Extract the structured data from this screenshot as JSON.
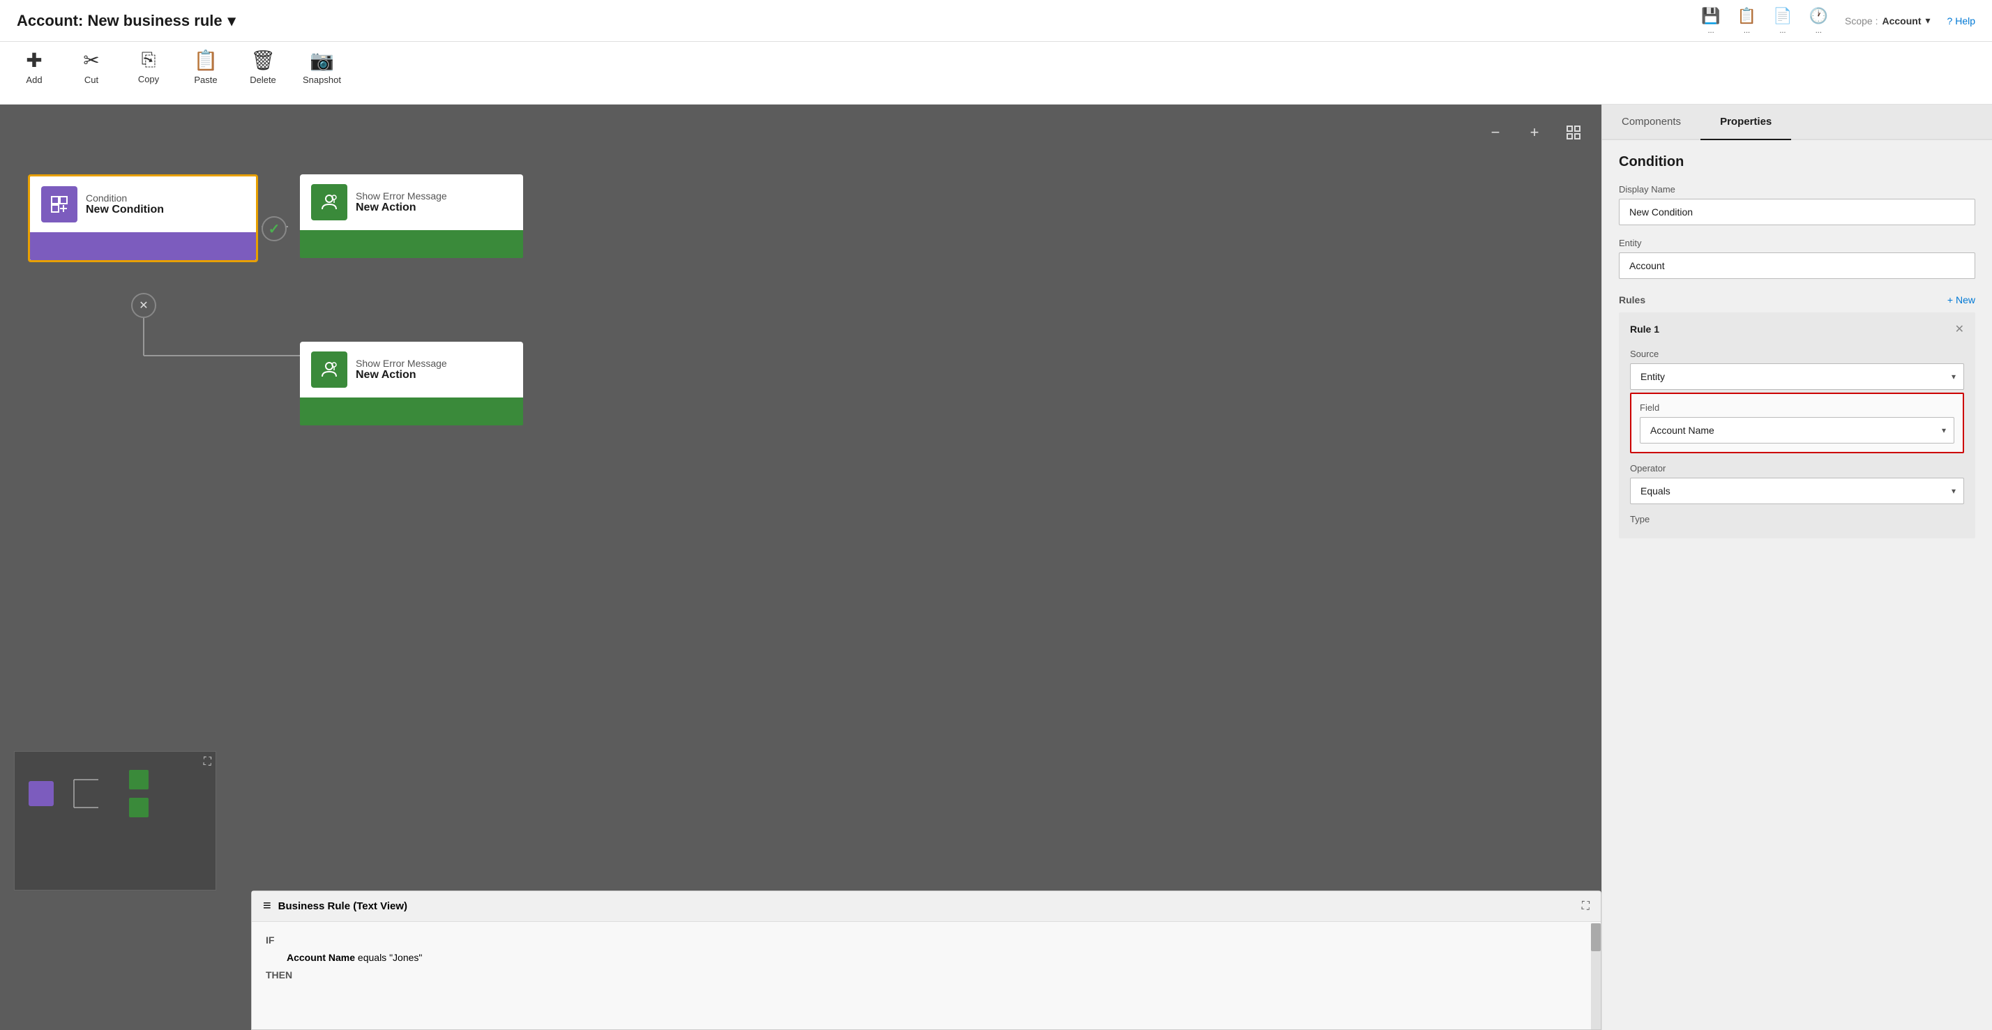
{
  "titleBar": {
    "title": "Account: New business rule",
    "chevronIcon": "▾",
    "icons": [
      {
        "name": "save-icon",
        "symbol": "💾",
        "label": ""
      },
      {
        "name": "checklist-icon",
        "symbol": "📋",
        "label": ""
      },
      {
        "name": "validate-icon",
        "symbol": "📄",
        "label": ""
      },
      {
        "name": "clock-icon",
        "symbol": "🕐",
        "label": ""
      }
    ],
    "scopeLabel": "Scope :",
    "scopeValue": "Account",
    "scopeChevron": "▾",
    "helpLabel": "? Help"
  },
  "toolbar": {
    "items": [
      {
        "name": "add-tool",
        "icon": "+",
        "label": "Add"
      },
      {
        "name": "cut-tool",
        "icon": "✂",
        "label": "Cut"
      },
      {
        "name": "copy-tool",
        "icon": "⎘",
        "label": "Copy"
      },
      {
        "name": "paste-tool",
        "icon": "📋",
        "label": "Paste"
      },
      {
        "name": "delete-tool",
        "icon": "🗑",
        "label": "Delete"
      },
      {
        "name": "snapshot-tool",
        "icon": "📷",
        "label": "Snapshot"
      }
    ]
  },
  "canvas": {
    "zoomOutIcon": "−",
    "zoomInIcon": "+",
    "fitIcon": "⛶",
    "conditionNode": {
      "iconSymbol": "⊞",
      "label": "Condition",
      "title": "New Condition"
    },
    "actionNodeTop": {
      "iconSymbol": "👤",
      "label": "Show Error Message",
      "title": "New Action"
    },
    "actionNodeBottom": {
      "iconSymbol": "👤",
      "label": "Show Error Message",
      "title": "New Action"
    },
    "connectorCheckSymbol": "✓",
    "connectorXSymbol": "✕"
  },
  "textView": {
    "headerIcon": "≡",
    "title": "Business Rule (Text View)",
    "expandIcon": "⛶",
    "ifLabel": "IF",
    "thenLabel": "THEN",
    "ifContent": "Account Name equals \"Jones\"",
    "thenContent": ""
  },
  "rightPanel": {
    "tabs": [
      {
        "name": "components-tab",
        "label": "Components"
      },
      {
        "name": "properties-tab",
        "label": "Properties",
        "active": true
      }
    ],
    "sectionTitle": "Condition",
    "fields": {
      "displayNameLabel": "Display Name",
      "displayNameValue": "New Condition",
      "entityLabel": "Entity",
      "entityValue": "Account"
    },
    "rules": {
      "label": "Rules",
      "newLabel": "+ New",
      "rule1": {
        "title": "Rule 1",
        "closeIcon": "✕",
        "sourceLabel": "Source",
        "sourceValue": "Entity",
        "fieldLabel": "Field",
        "fieldValue": "Account Name",
        "operatorLabel": "Operator",
        "operatorValue": "Equals",
        "typeLabel": "Type"
      }
    }
  }
}
